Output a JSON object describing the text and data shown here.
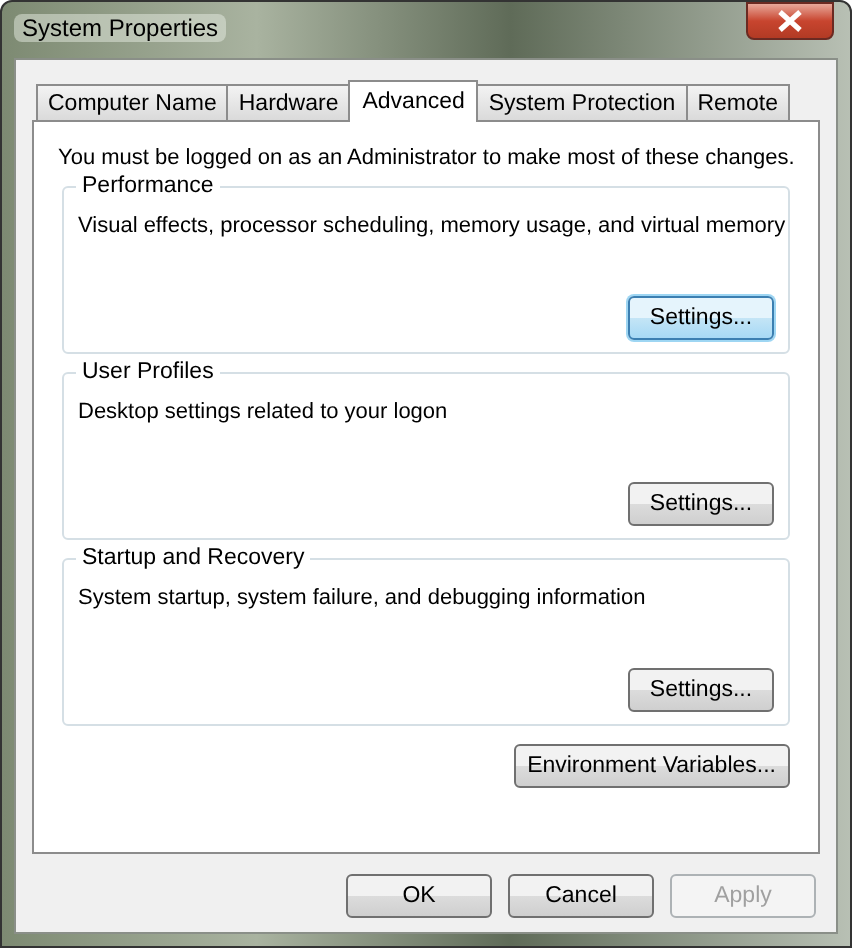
{
  "window": {
    "title": "System Properties"
  },
  "tabs": [
    {
      "label": "Computer Name",
      "selected": false
    },
    {
      "label": "Hardware",
      "selected": false
    },
    {
      "label": "Advanced",
      "selected": true
    },
    {
      "label": "System Protection",
      "selected": false
    },
    {
      "label": "Remote",
      "selected": false
    }
  ],
  "notice": "You must be logged on as an Administrator to make most of these changes.",
  "groups": [
    {
      "title": "Performance",
      "description": "Visual effects, processor scheduling, memory usage, and virtual memory",
      "button": {
        "label": "Settings...",
        "focused": true
      }
    },
    {
      "title": "User Profiles",
      "description": "Desktop settings related to your logon",
      "button": {
        "label": "Settings...",
        "focused": false
      }
    },
    {
      "title": "Startup and Recovery",
      "description": "System startup, system failure, and debugging information",
      "button": {
        "label": "Settings...",
        "focused": false
      }
    }
  ],
  "environment_button": {
    "label": "Environment Variables...",
    "disabled": false
  },
  "buttons": [
    {
      "label": "OK",
      "disabled": false
    },
    {
      "label": "Cancel",
      "disabled": false
    },
    {
      "label": "Apply",
      "disabled": true
    }
  ]
}
